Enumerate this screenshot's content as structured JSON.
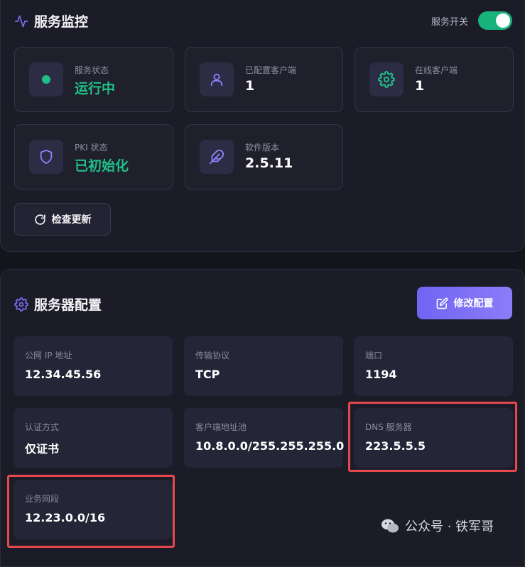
{
  "monitor": {
    "title": "服务监控",
    "toggle_label": "服务开关",
    "toggle_on": true,
    "cards": [
      {
        "icon": "status-dot-icon",
        "label": "服务状态",
        "value": "运行中"
      },
      {
        "icon": "user-icon",
        "label": "已配置客户端",
        "value": "1"
      },
      {
        "icon": "gear-icon",
        "label": "在线客户端",
        "value": "1"
      },
      {
        "icon": "shield-icon",
        "label": "PKI 状态",
        "value": "已初始化"
      },
      {
        "icon": "feather-icon",
        "label": "软件版本",
        "value": "2.5.11"
      }
    ],
    "check_update_label": "检查更新"
  },
  "config": {
    "title": "服务器配置",
    "edit_label": "修改配置",
    "items": [
      {
        "label": "公网 IP 地址",
        "value": "12.34.45.56"
      },
      {
        "label": "传输协议",
        "value": "TCP"
      },
      {
        "label": "端口",
        "value": "1194"
      },
      {
        "label": "认证方式",
        "value": "仅证书"
      },
      {
        "label": "客户端地址池",
        "value": "10.8.0.0/255.255.255.0"
      },
      {
        "label": "DNS 服务器",
        "value": "223.5.5.5"
      },
      {
        "label": "业务网段",
        "value": "12.23.0.0/16"
      }
    ]
  },
  "watermark": "公众号 · 铁军哥",
  "colors": {
    "accent": "#7b6ff5",
    "success": "#1fc086",
    "highlight": "#e5484d"
  }
}
